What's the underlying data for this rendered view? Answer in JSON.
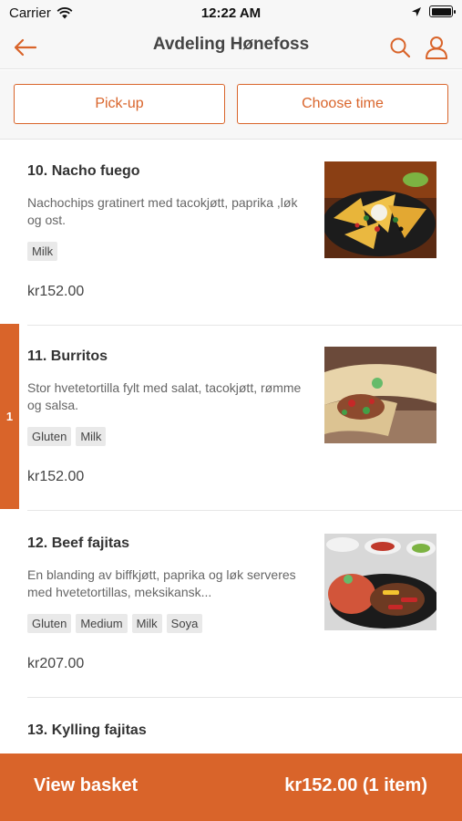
{
  "status_bar": {
    "carrier": "Carrier",
    "time": "12:22 AM"
  },
  "header": {
    "title": "Avdeling Hønefoss"
  },
  "actions": {
    "pickup_label": "Pick-up",
    "choose_time_label": "Choose time"
  },
  "colors": {
    "accent": "#d9642a",
    "tag_bg": "#e9e9e9"
  },
  "menu": {
    "items": [
      {
        "title": "10. Nacho fuego",
        "desc": "Nachochips gratinert med tacokjøtt, paprika ,løk og ost.",
        "tags": [
          "Milk"
        ],
        "price": "kr152.00"
      },
      {
        "title": "11. Burritos",
        "desc": "Stor hvetetortilla fylt med salat, tacokjøtt, rømme og salsa.",
        "tags": [
          "Gluten",
          "Milk"
        ],
        "price": "kr152.00",
        "quantity": "1"
      },
      {
        "title": "12. Beef fajitas",
        "desc": "En blanding av biffkjøtt, paprika og løk serveres med hvetetortillas, meksikansk...",
        "tags": [
          "Gluten",
          "Medium",
          "Milk",
          "Soya"
        ],
        "price": "kr207.00"
      },
      {
        "title": "13. Kylling fajitas"
      }
    ]
  },
  "footer": {
    "view_basket": "View basket",
    "total": "kr152.00 (1 item)"
  }
}
